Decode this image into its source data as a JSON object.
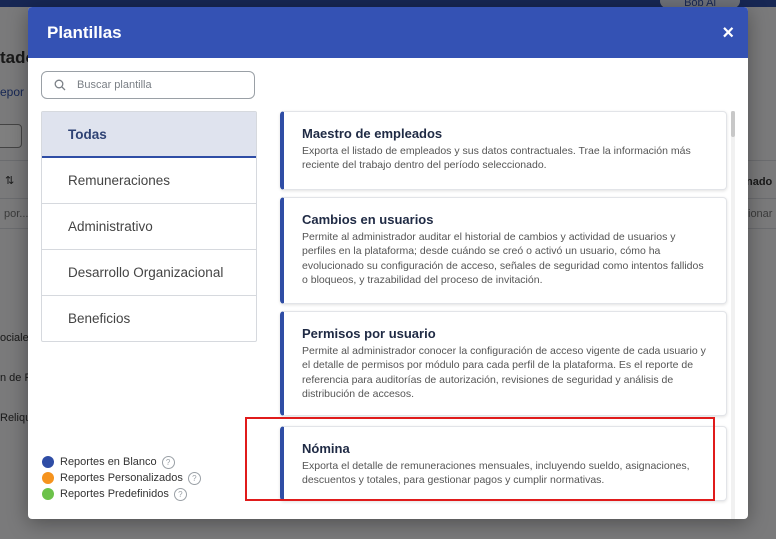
{
  "background": {
    "user_chip": "Bob Al",
    "fragments": {
      "tado": "tado",
      "repo": "epor",
      "nado": "nado",
      "por": "por...",
      "ionar": "ionar",
      "ociales": "ociales",
      "en_r": "n de R",
      "reliqui": "Reliqui"
    }
  },
  "modal": {
    "title": "Plantillas",
    "close_label": "×",
    "search": {
      "placeholder": "Buscar plantilla",
      "value": ""
    },
    "categories": [
      {
        "label": "Todas",
        "active": true
      },
      {
        "label": "Remuneraciones",
        "active": false
      },
      {
        "label": "Administrativo",
        "active": false
      },
      {
        "label": "Desarrollo Organizacional",
        "active": false
      },
      {
        "label": "Beneficios",
        "active": false
      }
    ],
    "legend": [
      {
        "label": "Reportes en Blanco",
        "color": "#2f4da5",
        "help": "?"
      },
      {
        "label": "Reportes Personalizados",
        "color": "#f5931e",
        "help": "?"
      },
      {
        "label": "Reportes Predefinidos",
        "color": "#6cc24a",
        "help": "?"
      }
    ],
    "templates": [
      {
        "title": "Maestro de empleados",
        "description": "Exporta el listado de empleados y sus datos contractuales. Trae la información más reciente del trabajo dentro del período seleccionado."
      },
      {
        "title": "Cambios en usuarios",
        "description": "Permite al administrador auditar el historial de cambios y actividad de usuarios y perfiles en la plataforma; desde cuándo se creó o activó un usuario, cómo ha evolucionado su configuración de acceso, señales de seguridad como intentos fallidos o bloqueos, y trazabilidad del proceso de invitación."
      },
      {
        "title": "Permisos por usuario",
        "description": "Permite al administrador conocer la configuración de acceso vigente de cada usuario y el detalle de permisos por módulo para cada perfil de la plataforma. Es el reporte de referencia para auditorías de autorización, revisiones de seguridad y análisis de distribución de accesos."
      },
      {
        "title": "Nómina",
        "description": "Exporta el detalle de remuneraciones mensuales, incluyendo sueldo, asignaciones, descuentos y totales, para gestionar pagos y cumplir normativas."
      }
    ],
    "highlight_color": "#e01b1b"
  }
}
